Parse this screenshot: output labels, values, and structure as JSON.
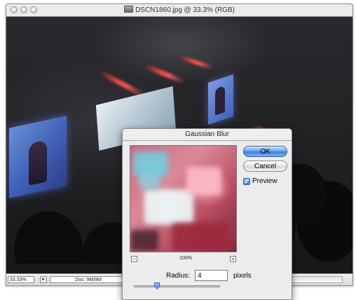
{
  "document": {
    "title": "DSCN1860.jpg @ 33.3% (RGB)",
    "zoom": "33.33%",
    "doc_info": "Doc: 9M/9M"
  },
  "dialog": {
    "title": "Gaussian Blur",
    "ok_label": "OK",
    "cancel_label": "Cancel",
    "preview_label": "Preview",
    "preview_checked": true,
    "preview_zoom": "100%",
    "radius_label": "Radius:",
    "radius_value": "4",
    "radius_unit": "pixels",
    "slider_value_fraction": 0.27
  },
  "colors": {
    "accent": "#3f80dc",
    "photo_beam": "#ff4646",
    "screen_blue": "#4a6cc8"
  }
}
